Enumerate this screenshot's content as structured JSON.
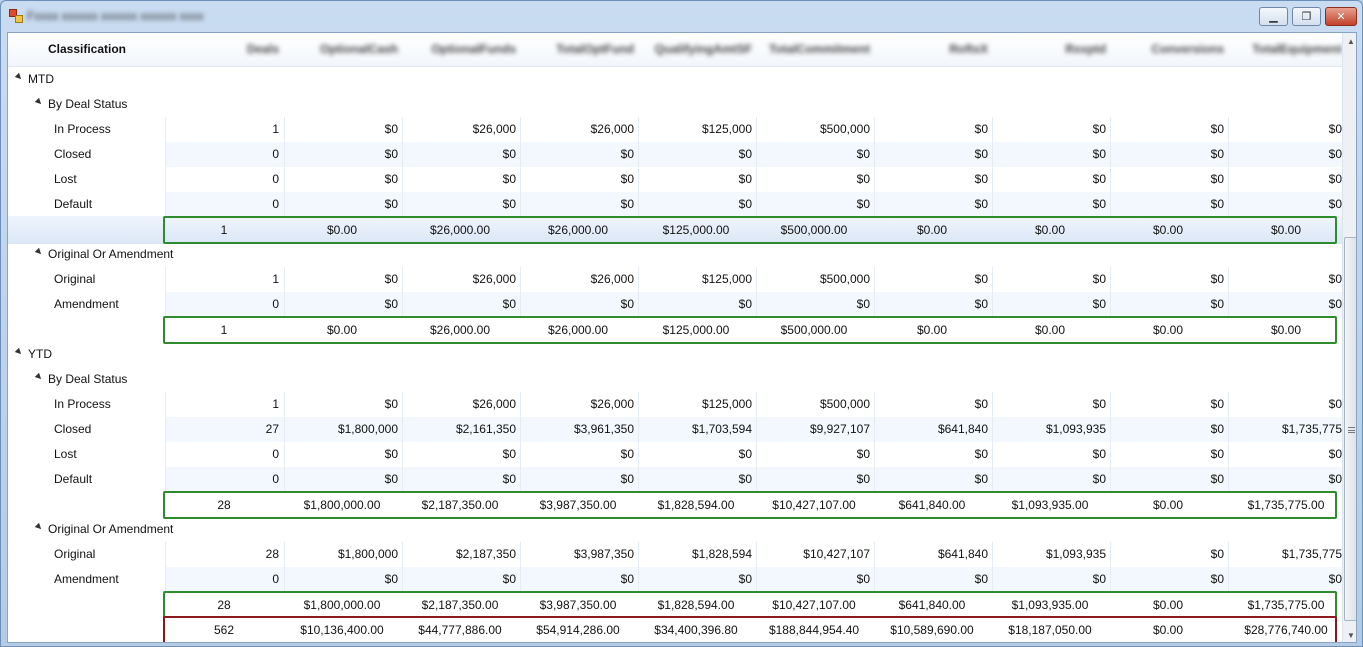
{
  "window": {
    "title": "Fxxxx xxxxxx xxxxxx xxxxxx xxxx",
    "buttons": {
      "minimize": "▁",
      "maximize": "❐",
      "close": "✕"
    }
  },
  "header": {
    "classification": "Classification",
    "columns": [
      "Deals",
      "OptionalCash",
      "OptionalFunds",
      "TotalOptFund",
      "QualifyingAmtSF",
      "TotalCommitment",
      "RoftxX",
      "Rxxptd",
      "Conversions",
      "TotalEquipment"
    ]
  },
  "rows": [
    {
      "label": "MTD",
      "indent": 0,
      "expander": true,
      "values": []
    },
    {
      "label": "By Deal Status",
      "indent": 1,
      "expander": true,
      "values": []
    },
    {
      "label": "In Process",
      "indent": 2,
      "values": [
        "1",
        "$0",
        "$26,000",
        "$26,000",
        "$125,000",
        "$500,000",
        "$0",
        "$0",
        "$0",
        "$0"
      ]
    },
    {
      "label": "Closed",
      "indent": 2,
      "values": [
        "0",
        "$0",
        "$0",
        "$0",
        "$0",
        "$0",
        "$0",
        "$0",
        "$0",
        "$0"
      ]
    },
    {
      "label": "Lost",
      "indent": 2,
      "values": [
        "0",
        "$0",
        "$0",
        "$0",
        "$0",
        "$0",
        "$0",
        "$0",
        "$0",
        "$0"
      ]
    },
    {
      "label": "Default",
      "indent": 2,
      "values": [
        "0",
        "$0",
        "$0",
        "$0",
        "$0",
        "$0",
        "$0",
        "$0",
        "$0",
        "$0"
      ]
    },
    {
      "summary": true,
      "selected": true,
      "values": [
        "1",
        "$0.00",
        "$26,000.00",
        "$26,000.00",
        "$125,000.00",
        "$500,000.00",
        "$0.00",
        "$0.00",
        "$0.00",
        "$0.00"
      ]
    },
    {
      "label": "Original Or Amendment",
      "indent": 1,
      "expander": true,
      "values": []
    },
    {
      "label": "Original",
      "indent": 2,
      "values": [
        "1",
        "$0",
        "$26,000",
        "$26,000",
        "$125,000",
        "$500,000",
        "$0",
        "$0",
        "$0",
        "$0"
      ]
    },
    {
      "label": "Amendment",
      "indent": 2,
      "values": [
        "0",
        "$0",
        "$0",
        "$0",
        "$0",
        "$0",
        "$0",
        "$0",
        "$0",
        "$0"
      ]
    },
    {
      "summary": true,
      "values": [
        "1",
        "$0.00",
        "$26,000.00",
        "$26,000.00",
        "$125,000.00",
        "$500,000.00",
        "$0.00",
        "$0.00",
        "$0.00",
        "$0.00"
      ]
    },
    {
      "label": "YTD",
      "indent": 0,
      "expander": true,
      "values": []
    },
    {
      "label": "By Deal Status",
      "indent": 1,
      "expander": true,
      "values": []
    },
    {
      "label": "In Process",
      "indent": 2,
      "values": [
        "1",
        "$0",
        "$26,000",
        "$26,000",
        "$125,000",
        "$500,000",
        "$0",
        "$0",
        "$0",
        "$0"
      ]
    },
    {
      "label": "Closed",
      "indent": 2,
      "values": [
        "27",
        "$1,800,000",
        "$2,161,350",
        "$3,961,350",
        "$1,703,594",
        "$9,927,107",
        "$641,840",
        "$1,093,935",
        "$0",
        "$1,735,775"
      ]
    },
    {
      "label": "Lost",
      "indent": 2,
      "values": [
        "0",
        "$0",
        "$0",
        "$0",
        "$0",
        "$0",
        "$0",
        "$0",
        "$0",
        "$0"
      ]
    },
    {
      "label": "Default",
      "indent": 2,
      "values": [
        "0",
        "$0",
        "$0",
        "$0",
        "$0",
        "$0",
        "$0",
        "$0",
        "$0",
        "$0"
      ]
    },
    {
      "summary": true,
      "values": [
        "28",
        "$1,800,000.00",
        "$2,187,350.00",
        "$3,987,350.00",
        "$1,828,594.00",
        "$10,427,107.00",
        "$641,840.00",
        "$1,093,935.00",
        "$0.00",
        "$1,735,775.00"
      ]
    },
    {
      "label": "Original Or Amendment",
      "indent": 1,
      "expander": true,
      "values": []
    },
    {
      "label": "Original",
      "indent": 2,
      "values": [
        "28",
        "$1,800,000",
        "$2,187,350",
        "$3,987,350",
        "$1,828,594",
        "$10,427,107",
        "$641,840",
        "$1,093,935",
        "$0",
        "$1,735,775"
      ]
    },
    {
      "label": "Amendment",
      "indent": 2,
      "values": [
        "0",
        "$0",
        "$0",
        "$0",
        "$0",
        "$0",
        "$0",
        "$0",
        "$0",
        "$0"
      ]
    },
    {
      "summary": true,
      "values": [
        "28",
        "$1,800,000.00",
        "$2,187,350.00",
        "$3,987,350.00",
        "$1,828,594.00",
        "$10,427,107.00",
        "$641,840.00",
        "$1,093,935.00",
        "$0.00",
        "$1,735,775.00"
      ]
    },
    {
      "summary": true,
      "grand": true,
      "values": [
        "562",
        "$10,136,400.00",
        "$44,777,886.00",
        "$54,914,286.00",
        "$34,400,396.80",
        "$188,844,954.40",
        "$10,589,690.00",
        "$18,187,050.00",
        "$0.00",
        "$28,776,740.00"
      ]
    }
  ],
  "colors": {
    "summary_border": "#2e8b2e",
    "grand_border": "#8b1a1a",
    "alt_row": "#f2f8fd",
    "selected_row": "#dce8f7"
  },
  "scrollbar": {
    "up": "▲",
    "down": "▼"
  }
}
